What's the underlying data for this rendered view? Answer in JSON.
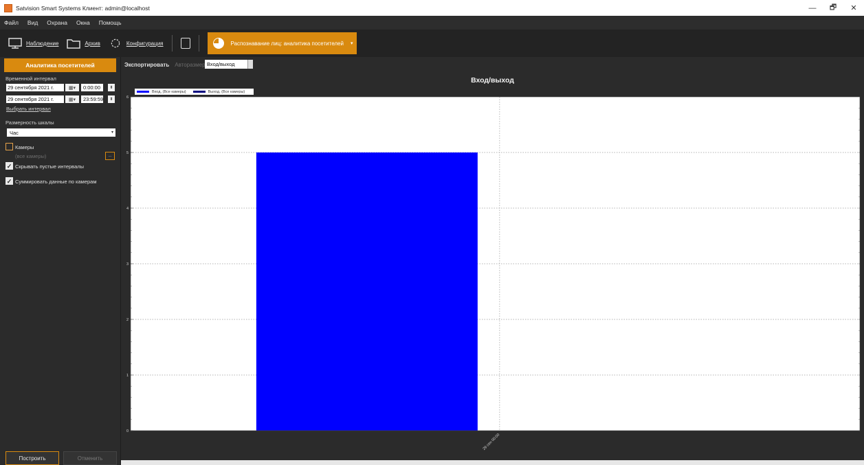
{
  "window": {
    "title": "Satvision Smart Systems Клиент: admin@localhost",
    "controls": [
      "—",
      "🗗",
      "✕"
    ]
  },
  "menu": {
    "items": [
      "Файл",
      "Вид",
      "Охрана",
      "Окна",
      "Помощь"
    ]
  },
  "toolbar": {
    "monitoring_label": "Наблюдение",
    "archive_label": "Архив",
    "config_label": "Конфигурация",
    "active_tab_label": "Распознавание лиц: аналитика посетителей",
    "active_caret": "▾",
    "accent_color": "#d98a0f"
  },
  "left_panel": {
    "header": "Аналитика посетителей",
    "interval_label": "Временной интервал",
    "start_date": "29 сентября 2021 г.",
    "start_time": "0:00:00",
    "end_date": "29 сентября 2021 г.",
    "end_time": "23:59:59",
    "calendar_symbol": "▦▾",
    "spin_symbol": "⬍",
    "choose_interval": "Выбрать интервал",
    "scale_label": "Размерность шкалы",
    "scale_value": "Час",
    "select_arrow": "▾",
    "cameras_label": "Камеры",
    "cameras_value": "(все камеры)",
    "cameras_btn": "...",
    "hide_empty_label": "Скрывать пустые интервалы",
    "hide_empty_checked": true,
    "sum_cameras_label": "Суммировать данные по камерам",
    "sum_cameras_checked": true,
    "check_mark": "✓",
    "build_button": "Построить",
    "cancel_button": "Отменить"
  },
  "content_toolbar": {
    "export_label": "Экспортировать",
    "autosize_label": "Авторазмер",
    "mode_value": "Вход/выход"
  },
  "chart_data": {
    "type": "bar",
    "title": "Вход/выход",
    "categories": [
      "29 сен 00:00"
    ],
    "series": [
      {
        "name": "Вход, (Все камеры)",
        "color": "#0000ff",
        "values": [
          5
        ]
      },
      {
        "name": "Выход, (Все камеры)",
        "color": "#00007f",
        "values": [
          0
        ]
      }
    ],
    "ylim": [
      0,
      6
    ],
    "yticks": [
      "0",
      "1",
      "2",
      "3",
      "4",
      "5",
      "6"
    ],
    "grid": true,
    "legend_position": "top-left"
  }
}
